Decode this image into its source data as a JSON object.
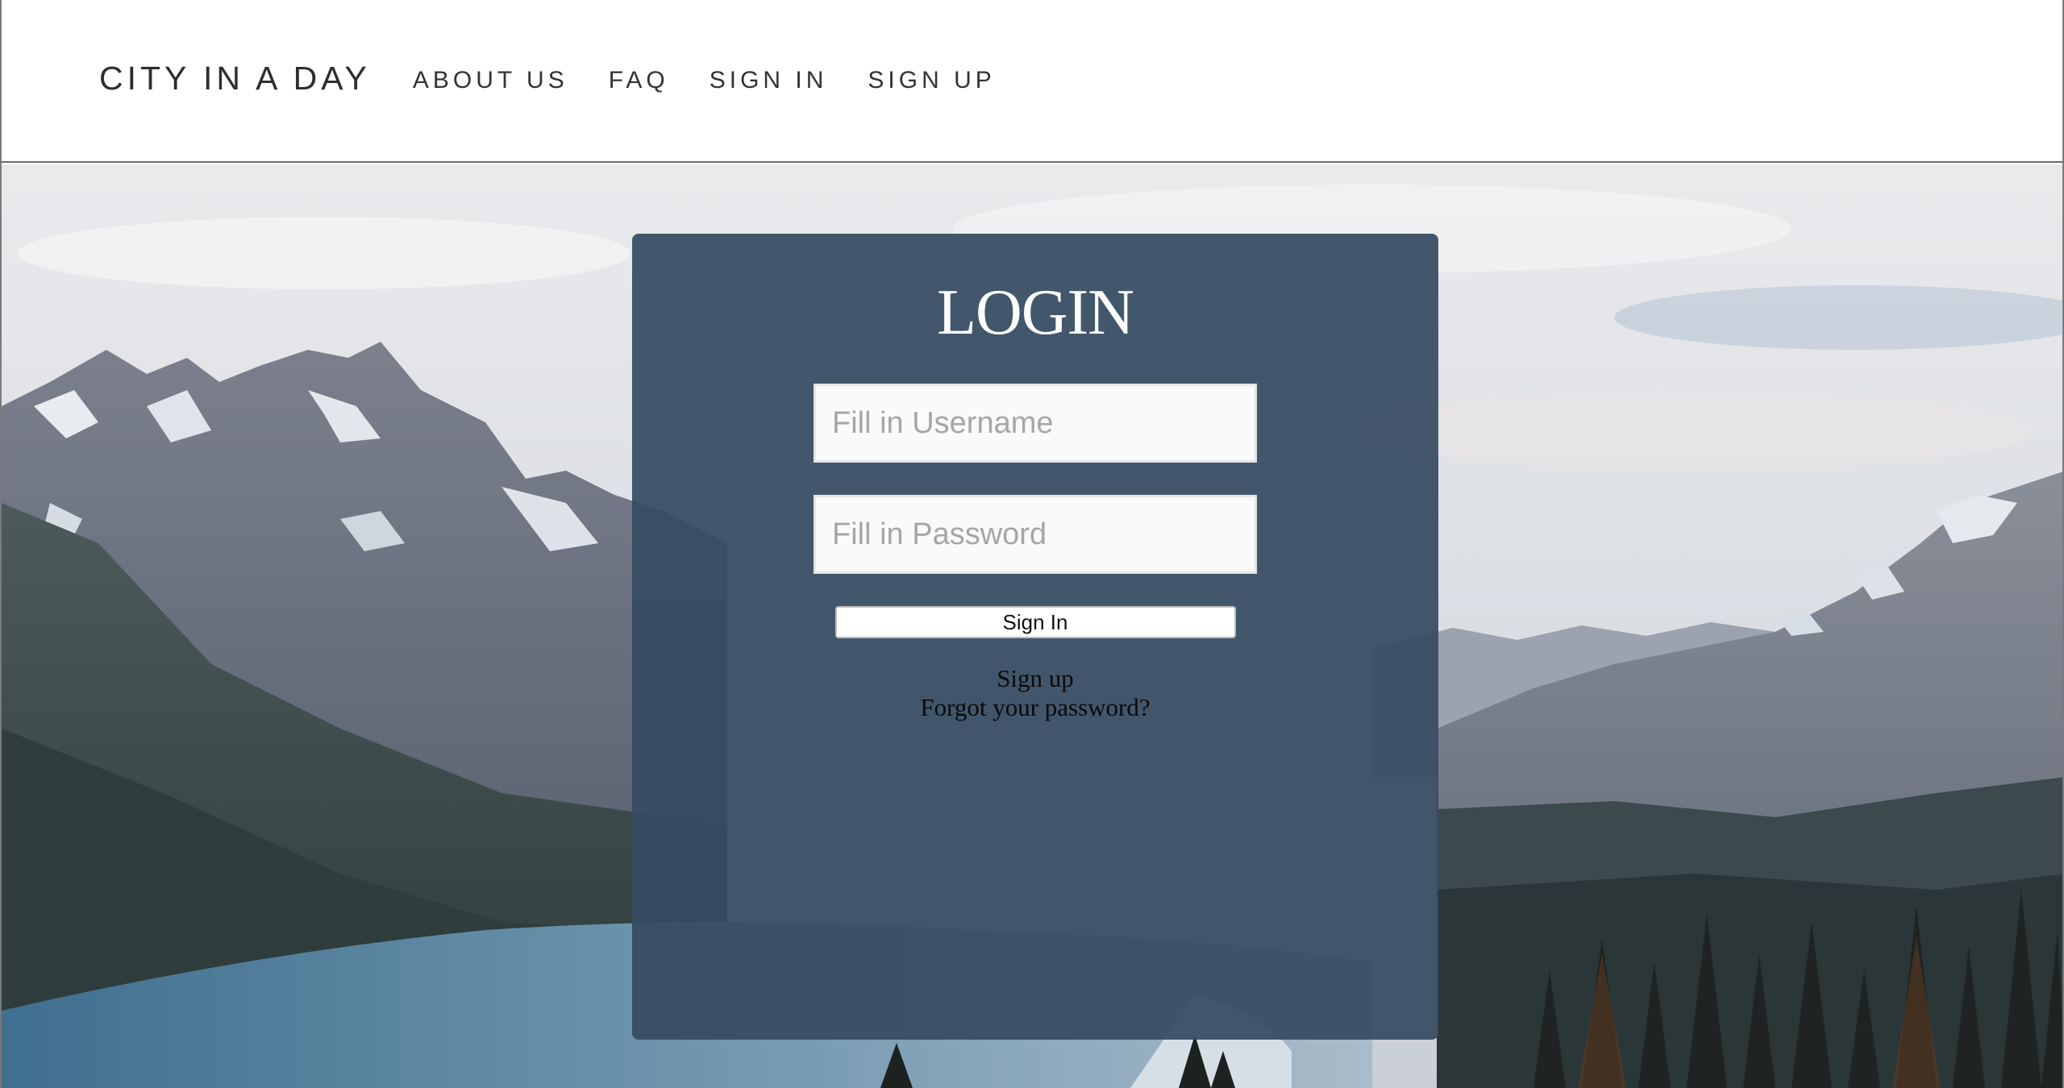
{
  "nav": {
    "brand": "CITY IN A DAY",
    "links": [
      "ABOUT US",
      "FAQ",
      "SIGN IN",
      "SIGN UP"
    ]
  },
  "login": {
    "title": "LOGIN",
    "username_placeholder": "Fill in Username",
    "password_placeholder": "Fill in Password",
    "submit_label": "Sign In",
    "signup_link": "Sign up",
    "forgot_link": "Forgot your password?"
  },
  "background": {
    "scene": "mountain-lake-landscape",
    "card_color": "#364b62"
  }
}
